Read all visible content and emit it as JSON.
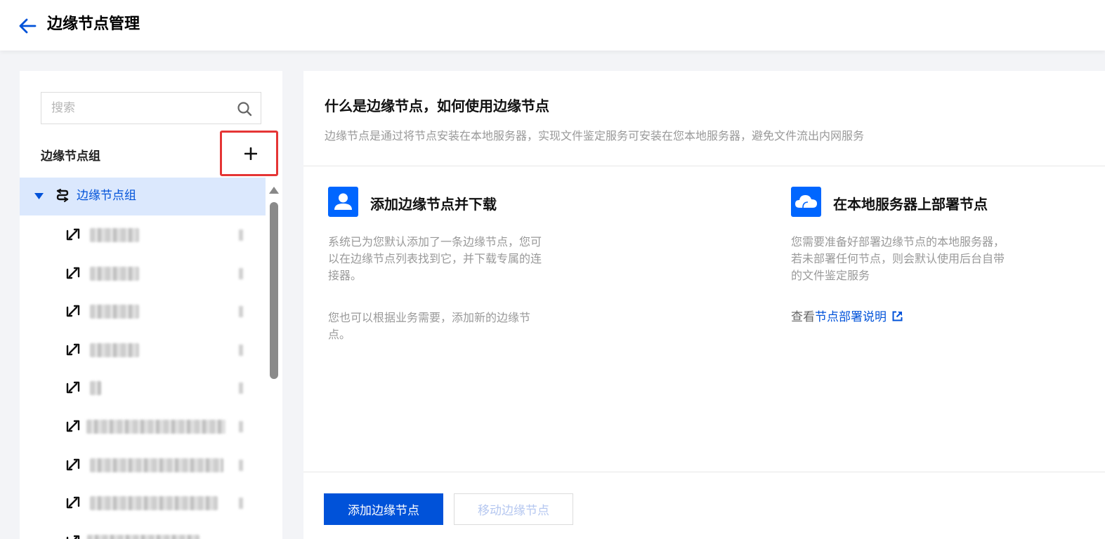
{
  "header": {
    "title": "边缘节点管理"
  },
  "sidebar": {
    "search_placeholder": "搜索",
    "group_header_label": "边缘节点组",
    "tree": {
      "root_label": "边缘节点组",
      "items_count_visible": 9
    }
  },
  "main": {
    "intro_title": "什么是边缘节点，如何使用边缘节点",
    "intro_desc": "边缘节点是通过将节点安装在本地服务器，实现文件鉴定服务可安装在您本地服务器，避免文件流出内网服务",
    "card_1": {
      "icon": "user-icon",
      "title": "添加边缘节点并下载",
      "text": "系统已为您默认添加了一条边缘节点，您可以在边缘节点列表找到它，并下载专属的连接器。",
      "text_2": "您也可以根据业务需要，添加新的边缘节点。"
    },
    "card_2": {
      "icon": "cloud-icon",
      "title": "在本地服务器上部署节点",
      "text": "您需要准备好部署边缘节点的本地服务器，若未部署任何节点，则会默认使用后台自带的文件鉴定服务",
      "view_prefix": "查看",
      "link_label": "节点部署说明"
    },
    "add_button_label": "添加边缘节点",
    "move_button_label": "移动边缘节点"
  },
  "colors": {
    "primary": "#0052d9",
    "highlight_border": "#e53535",
    "selected_row": "#dbe8fd"
  }
}
